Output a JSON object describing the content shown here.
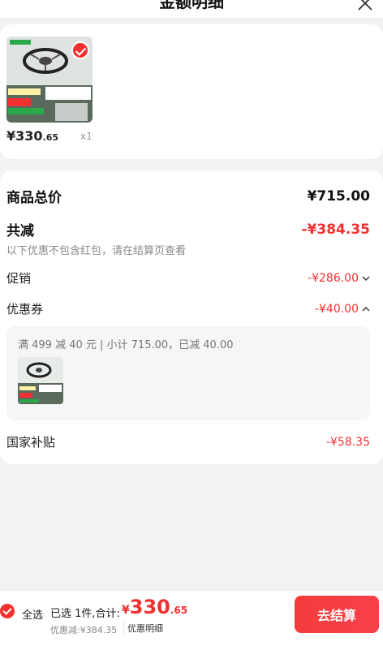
{
  "header": {
    "title": "金额明细"
  },
  "product": {
    "price_symbol": "¥",
    "price_int": "330",
    "price_dec": ".65",
    "quantity": "x1"
  },
  "summary": {
    "total_label": "商品总价",
    "total_value": "¥715.00",
    "reduce_label": "共减",
    "reduce_value": "-¥384.35",
    "note": "以下优惠不包含红包，请在结算页查看",
    "promo_label": "促销",
    "promo_value": "-¥286.00",
    "coupon_label": "优惠券",
    "coupon_value": "-¥40.00",
    "coupon_detail": "满 499 减 40 元 | 小计 715.00，已减 40.00",
    "subsidy_label": "国家补贴",
    "subsidy_value": "-¥58.35"
  },
  "footer": {
    "select_all": "全选",
    "selected_text": "已选 1件,合计:",
    "total_symbol": "¥",
    "total_int": "330",
    "total_dec": ".65",
    "discount_text": "优惠减:¥384.35",
    "detail_link": "优惠明细",
    "checkout": "去结算"
  },
  "colors": {
    "accent": "#f23030",
    "background": "#f2f2f2",
    "card": "#ffffff"
  }
}
